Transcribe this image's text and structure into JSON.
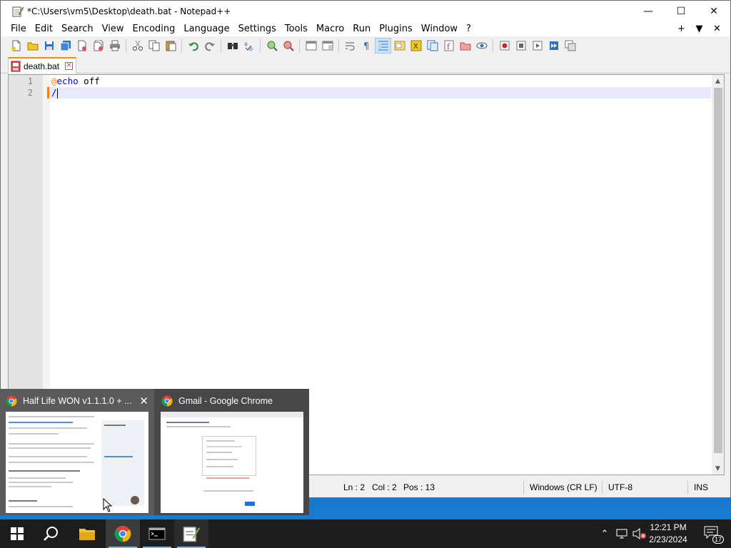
{
  "window": {
    "title": "*C:\\Users\\vm5\\Desktop\\death.bat - Notepad++",
    "controls": {
      "minimize": "—",
      "maximize": "☐",
      "close": "✕"
    }
  },
  "menu": {
    "items": [
      "File",
      "Edit",
      "Search",
      "View",
      "Encoding",
      "Language",
      "Settings",
      "Tools",
      "Macro",
      "Run",
      "Plugins",
      "Window",
      "?"
    ],
    "right": {
      "plus": "+",
      "down": "▼",
      "close": "✕"
    }
  },
  "toolbar": {
    "icons": [
      "new-file-icon",
      "open-file-icon",
      "save-icon",
      "save-all-icon",
      "close-icon",
      "close-all-icon",
      "print-icon",
      "cut-icon",
      "copy-icon",
      "paste-icon",
      "undo-icon",
      "redo-icon",
      "find-icon",
      "replace-icon",
      "zoom-in-icon",
      "zoom-out-icon",
      "sync-v-icon",
      "sync-h-icon",
      "word-wrap-icon",
      "all-chars-icon",
      "indent-guide-icon",
      "udl-icon",
      "doc-map-icon",
      "doc-list-icon",
      "function-list-icon",
      "folder-workspace-icon",
      "monitor-icon",
      "record-macro-icon",
      "stop-macro-icon",
      "play-macro-icon",
      "run-macro-multiple-icon",
      "save-macro-icon"
    ]
  },
  "tab": {
    "label": "death.bat",
    "close": "✕"
  },
  "editor": {
    "lines": [
      {
        "number": "1",
        "at": "@",
        "keyword": "echo",
        "rest": " off"
      },
      {
        "number": "2",
        "text": "/"
      }
    ]
  },
  "statusbar": {
    "ln": "Ln : 2",
    "col": "Col : 2",
    "pos": "Pos : 13",
    "eol": "Windows (CR LF)",
    "encoding": "UTF-8",
    "mode": "INS"
  },
  "thumbnails": [
    {
      "title": "Half Life WON v1.1.1.0 + ...",
      "close": "✕"
    },
    {
      "title": "Gmail - Google Chrome"
    }
  ],
  "taskbar": {
    "items": [
      "start-icon",
      "search-icon",
      "file-explorer-icon",
      "chrome-icon",
      "terminal-icon",
      "notepadpp-icon"
    ],
    "time": "12:21 PM",
    "date": "2/23/2024",
    "notifications": "17"
  },
  "colors": {
    "tab_accent": "#ff8c00",
    "current_line": "#e8e8ff",
    "keyword": "#0000ff",
    "at_symbol": "#ff8000",
    "taskbar": "#1c1c1c"
  }
}
